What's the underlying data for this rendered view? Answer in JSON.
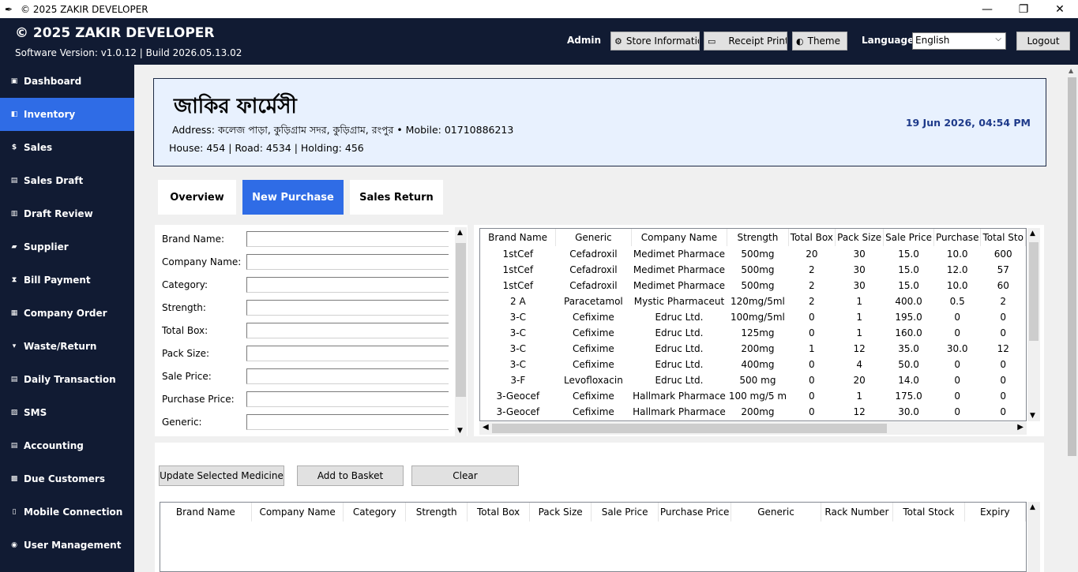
{
  "window": {
    "title": "© 2025 ZAKIR DEVELOPER",
    "minimize": "—",
    "restore": "❐",
    "close": "✕"
  },
  "header": {
    "brand": "© 2025 ZAKIR DEVELOPER",
    "version": "Software Version: v1.0.12  |  Build 2026.05.13.02",
    "user": "Admin",
    "store_info_label": "Store Informatio",
    "receipt_print_label": "Receipt Print",
    "theme_label": "Theme",
    "language_label": "Language:",
    "language_value": "English",
    "logout_label": "Logout"
  },
  "sidebar": {
    "items": [
      {
        "label": "Dashboard",
        "icon": "dashboard-icon",
        "glyph": "▣"
      },
      {
        "label": "Inventory",
        "icon": "inventory-icon",
        "glyph": "◧"
      },
      {
        "label": "Sales",
        "icon": "sales-icon",
        "glyph": "$"
      },
      {
        "label": "Sales Draft",
        "icon": "draft-icon",
        "glyph": "▤"
      },
      {
        "label": "Draft Review",
        "icon": "review-icon",
        "glyph": "▥"
      },
      {
        "label": "Supplier",
        "icon": "truck-icon",
        "glyph": "▰"
      },
      {
        "label": "Bill Payment",
        "icon": "hourglass-icon",
        "glyph": "⧗"
      },
      {
        "label": "Company Order",
        "icon": "order-icon",
        "glyph": "▦"
      },
      {
        "label": "Waste/Return",
        "icon": "bin-icon",
        "glyph": "▾"
      },
      {
        "label": "Daily Transaction",
        "icon": "transaction-icon",
        "glyph": "▤"
      },
      {
        "label": "SMS",
        "icon": "sms-icon",
        "glyph": "▨"
      },
      {
        "label": "Accounting",
        "icon": "accounting-icon",
        "glyph": "▤"
      },
      {
        "label": "Due Customers",
        "icon": "customers-icon",
        "glyph": "▩"
      },
      {
        "label": "Mobile Connection",
        "icon": "mobile-icon",
        "glyph": "▯"
      },
      {
        "label": "User Management",
        "icon": "user-icon",
        "glyph": "◉"
      }
    ]
  },
  "store": {
    "name": "জাকির ফার্মেসী",
    "address": "Address: কলেজ পাড়া, কুড়িগ্রাম সদর, কুড়িগ্রাম, রংপুর  •  Mobile: 01710886213",
    "house": "House: 454 | Road: 4534 | Holding: 456",
    "datetime": "19 Jun 2026, 04:54 PM"
  },
  "tabs": [
    "Overview",
    "New Purchase",
    "Sales Return"
  ],
  "form": {
    "fields": [
      {
        "label": "Brand Name:",
        "value": ""
      },
      {
        "label": "Company Name:",
        "value": ""
      },
      {
        "label": "Category:",
        "value": ""
      },
      {
        "label": "Strength:",
        "value": ""
      },
      {
        "label": "Total Box:",
        "value": ""
      },
      {
        "label": "Pack Size:",
        "value": ""
      },
      {
        "label": "Sale Price:",
        "value": ""
      },
      {
        "label": "Purchase Price:",
        "value": ""
      },
      {
        "label": "Generic:",
        "value": ""
      }
    ]
  },
  "medicine_table": {
    "columns": [
      "Brand Name",
      "Generic",
      "Company Name",
      "Strength",
      "Total Box",
      "Pack Size",
      "Sale Price",
      "Purchase",
      "Total Sto"
    ],
    "rows": [
      [
        "1stCef",
        "Cefadroxil",
        "Medimet Pharmace",
        "500mg",
        "20",
        "30",
        "15.0",
        "10.0",
        "600"
      ],
      [
        "1stCef",
        "Cefadroxil",
        "Medimet Pharmace",
        "500mg",
        "2",
        "30",
        "15.0",
        "12.0",
        "57"
      ],
      [
        "1stCef",
        "Cefadroxil",
        "Medimet Pharmace",
        "500mg",
        "2",
        "30",
        "15.0",
        "10.0",
        "60"
      ],
      [
        "2 A",
        "Paracetamol",
        "Mystic Pharmaceut",
        "120mg/5ml",
        "2",
        "1",
        "400.0",
        "0.5",
        "2"
      ],
      [
        "3-C",
        "Cefixime",
        "Edruc Ltd.",
        "100mg/5ml",
        "0",
        "1",
        "195.0",
        "0",
        "0"
      ],
      [
        "3-C",
        "Cefixime",
        "Edruc Ltd.",
        "125mg",
        "0",
        "1",
        "160.0",
        "0",
        "0"
      ],
      [
        "3-C",
        "Cefixime",
        "Edruc Ltd.",
        "200mg",
        "1",
        "12",
        "35.0",
        "30.0",
        "12"
      ],
      [
        "3-C",
        "Cefixime",
        "Edruc Ltd.",
        "400mg",
        "0",
        "4",
        "50.0",
        "0",
        "0"
      ],
      [
        "3-F",
        "Levofloxacin",
        "Edruc Ltd.",
        "500 mg",
        "0",
        "20",
        "14.0",
        "0",
        "0"
      ],
      [
        "3-Geocef",
        "Cefixime",
        "Hallmark Pharmace",
        "100 mg/5 m",
        "0",
        "1",
        "175.0",
        "0",
        "0"
      ],
      [
        "3-Geocef",
        "Cefixime",
        "Hallmark Pharmace",
        "200mg",
        "0",
        "12",
        "30.0",
        "0",
        "0"
      ]
    ]
  },
  "actions": {
    "update_label": "Update Selected Medicine",
    "add_label": "Add to Basket",
    "clear_label": "Clear"
  },
  "basket_table": {
    "columns": [
      "Brand Name",
      "Company Name",
      "Category",
      "Strength",
      "Total Box",
      "Pack Size",
      "Sale Price",
      "Purchase Price",
      "Generic",
      "Rack Number",
      "Total Stock",
      "Expiry"
    ],
    "rows": []
  },
  "colors": {
    "sidebar_bg": "#111b33",
    "accent": "#2f6ce6",
    "store_card_bg": "#e8f1fe",
    "datetime": "#1e3a8a"
  }
}
